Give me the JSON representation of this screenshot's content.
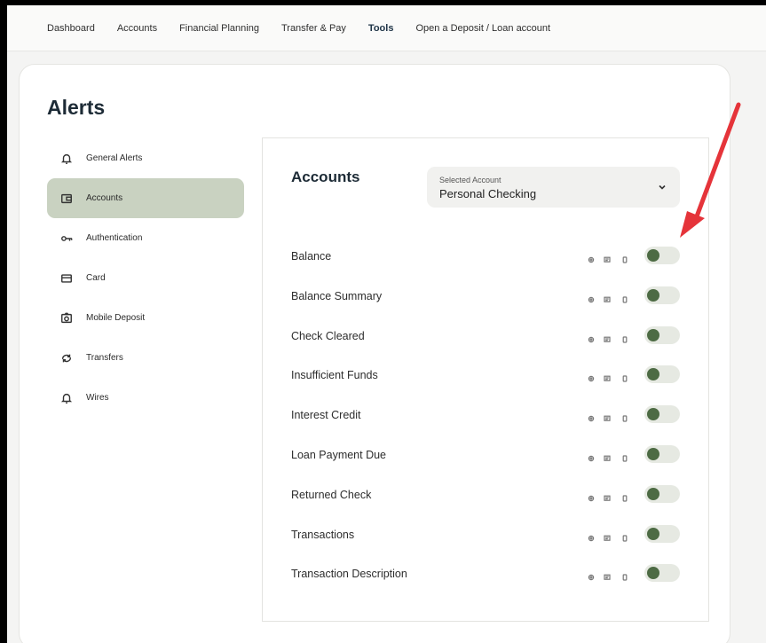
{
  "topnav": {
    "items": [
      "Dashboard",
      "Accounts",
      "Financial Planning",
      "Transfer & Pay",
      "Tools",
      "Open a Deposit / Loan account"
    ],
    "active_index": 4
  },
  "page": {
    "title": "Alerts"
  },
  "sidebar": {
    "items": [
      {
        "label": "General Alerts",
        "icon": "bell-icon"
      },
      {
        "label": "Accounts",
        "icon": "wallet-icon"
      },
      {
        "label": "Authentication",
        "icon": "key-icon"
      },
      {
        "label": "Card",
        "icon": "card-icon"
      },
      {
        "label": "Mobile Deposit",
        "icon": "camera-icon"
      },
      {
        "label": "Transfers",
        "icon": "transfer-icon"
      },
      {
        "label": "Wires",
        "icon": "bell-icon"
      }
    ],
    "active_index": 1
  },
  "panel": {
    "title": "Accounts",
    "select": {
      "label": "Selected Account",
      "value": "Personal Checking"
    },
    "alerts": [
      {
        "label": "Balance",
        "enabled": false
      },
      {
        "label": "Balance Summary",
        "enabled": false
      },
      {
        "label": "Check Cleared",
        "enabled": false
      },
      {
        "label": "Insufficient Funds",
        "enabled": false
      },
      {
        "label": "Interest Credit",
        "enabled": false
      },
      {
        "label": "Loan Payment Due",
        "enabled": false
      },
      {
        "label": "Returned Check",
        "enabled": false
      },
      {
        "label": "Transactions",
        "enabled": false
      },
      {
        "label": "Transaction Description",
        "enabled": false
      }
    ],
    "channel_icons": [
      "email-icon",
      "message-icon",
      "phone-icon"
    ]
  },
  "colors": {
    "accent": "#c9d2c1",
    "toggle_knob": "#4d6b44",
    "annotation_arrow": "#e5343a"
  }
}
